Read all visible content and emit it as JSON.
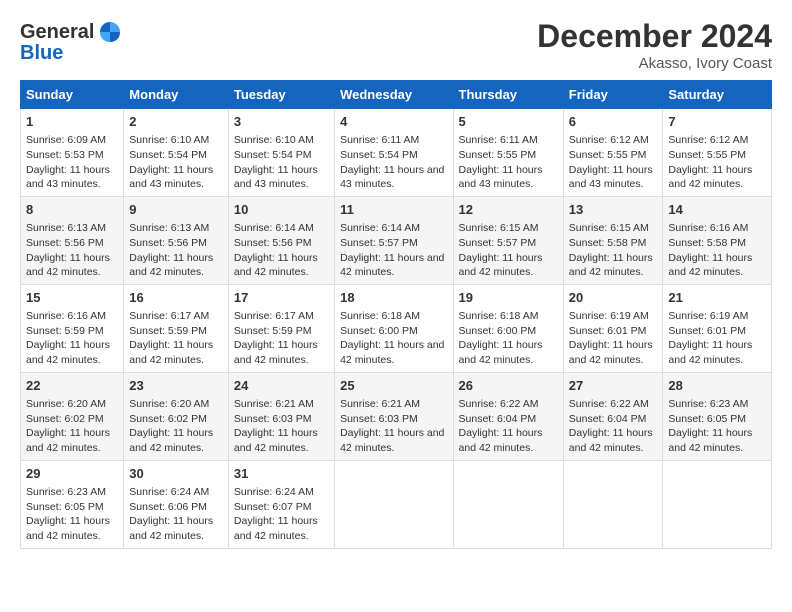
{
  "logo": {
    "line1": "General",
    "line2": "Blue"
  },
  "title": "December 2024",
  "subtitle": "Akasso, Ivory Coast",
  "days_of_week": [
    "Sunday",
    "Monday",
    "Tuesday",
    "Wednesday",
    "Thursday",
    "Friday",
    "Saturday"
  ],
  "weeks": [
    [
      {
        "day": "1",
        "sunrise": "Sunrise: 6:09 AM",
        "sunset": "Sunset: 5:53 PM",
        "daylight": "Daylight: 11 hours and 43 minutes."
      },
      {
        "day": "2",
        "sunrise": "Sunrise: 6:10 AM",
        "sunset": "Sunset: 5:54 PM",
        "daylight": "Daylight: 11 hours and 43 minutes."
      },
      {
        "day": "3",
        "sunrise": "Sunrise: 6:10 AM",
        "sunset": "Sunset: 5:54 PM",
        "daylight": "Daylight: 11 hours and 43 minutes."
      },
      {
        "day": "4",
        "sunrise": "Sunrise: 6:11 AM",
        "sunset": "Sunset: 5:54 PM",
        "daylight": "Daylight: 11 hours and 43 minutes."
      },
      {
        "day": "5",
        "sunrise": "Sunrise: 6:11 AM",
        "sunset": "Sunset: 5:55 PM",
        "daylight": "Daylight: 11 hours and 43 minutes."
      },
      {
        "day": "6",
        "sunrise": "Sunrise: 6:12 AM",
        "sunset": "Sunset: 5:55 PM",
        "daylight": "Daylight: 11 hours and 43 minutes."
      },
      {
        "day": "7",
        "sunrise": "Sunrise: 6:12 AM",
        "sunset": "Sunset: 5:55 PM",
        "daylight": "Daylight: 11 hours and 42 minutes."
      }
    ],
    [
      {
        "day": "8",
        "sunrise": "Sunrise: 6:13 AM",
        "sunset": "Sunset: 5:56 PM",
        "daylight": "Daylight: 11 hours and 42 minutes."
      },
      {
        "day": "9",
        "sunrise": "Sunrise: 6:13 AM",
        "sunset": "Sunset: 5:56 PM",
        "daylight": "Daylight: 11 hours and 42 minutes."
      },
      {
        "day": "10",
        "sunrise": "Sunrise: 6:14 AM",
        "sunset": "Sunset: 5:56 PM",
        "daylight": "Daylight: 11 hours and 42 minutes."
      },
      {
        "day": "11",
        "sunrise": "Sunrise: 6:14 AM",
        "sunset": "Sunset: 5:57 PM",
        "daylight": "Daylight: 11 hours and 42 minutes."
      },
      {
        "day": "12",
        "sunrise": "Sunrise: 6:15 AM",
        "sunset": "Sunset: 5:57 PM",
        "daylight": "Daylight: 11 hours and 42 minutes."
      },
      {
        "day": "13",
        "sunrise": "Sunrise: 6:15 AM",
        "sunset": "Sunset: 5:58 PM",
        "daylight": "Daylight: 11 hours and 42 minutes."
      },
      {
        "day": "14",
        "sunrise": "Sunrise: 6:16 AM",
        "sunset": "Sunset: 5:58 PM",
        "daylight": "Daylight: 11 hours and 42 minutes."
      }
    ],
    [
      {
        "day": "15",
        "sunrise": "Sunrise: 6:16 AM",
        "sunset": "Sunset: 5:59 PM",
        "daylight": "Daylight: 11 hours and 42 minutes."
      },
      {
        "day": "16",
        "sunrise": "Sunrise: 6:17 AM",
        "sunset": "Sunset: 5:59 PM",
        "daylight": "Daylight: 11 hours and 42 minutes."
      },
      {
        "day": "17",
        "sunrise": "Sunrise: 6:17 AM",
        "sunset": "Sunset: 5:59 PM",
        "daylight": "Daylight: 11 hours and 42 minutes."
      },
      {
        "day": "18",
        "sunrise": "Sunrise: 6:18 AM",
        "sunset": "Sunset: 6:00 PM",
        "daylight": "Daylight: 11 hours and 42 minutes."
      },
      {
        "day": "19",
        "sunrise": "Sunrise: 6:18 AM",
        "sunset": "Sunset: 6:00 PM",
        "daylight": "Daylight: 11 hours and 42 minutes."
      },
      {
        "day": "20",
        "sunrise": "Sunrise: 6:19 AM",
        "sunset": "Sunset: 6:01 PM",
        "daylight": "Daylight: 11 hours and 42 minutes."
      },
      {
        "day": "21",
        "sunrise": "Sunrise: 6:19 AM",
        "sunset": "Sunset: 6:01 PM",
        "daylight": "Daylight: 11 hours and 42 minutes."
      }
    ],
    [
      {
        "day": "22",
        "sunrise": "Sunrise: 6:20 AM",
        "sunset": "Sunset: 6:02 PM",
        "daylight": "Daylight: 11 hours and 42 minutes."
      },
      {
        "day": "23",
        "sunrise": "Sunrise: 6:20 AM",
        "sunset": "Sunset: 6:02 PM",
        "daylight": "Daylight: 11 hours and 42 minutes."
      },
      {
        "day": "24",
        "sunrise": "Sunrise: 6:21 AM",
        "sunset": "Sunset: 6:03 PM",
        "daylight": "Daylight: 11 hours and 42 minutes."
      },
      {
        "day": "25",
        "sunrise": "Sunrise: 6:21 AM",
        "sunset": "Sunset: 6:03 PM",
        "daylight": "Daylight: 11 hours and 42 minutes."
      },
      {
        "day": "26",
        "sunrise": "Sunrise: 6:22 AM",
        "sunset": "Sunset: 6:04 PM",
        "daylight": "Daylight: 11 hours and 42 minutes."
      },
      {
        "day": "27",
        "sunrise": "Sunrise: 6:22 AM",
        "sunset": "Sunset: 6:04 PM",
        "daylight": "Daylight: 11 hours and 42 minutes."
      },
      {
        "day": "28",
        "sunrise": "Sunrise: 6:23 AM",
        "sunset": "Sunset: 6:05 PM",
        "daylight": "Daylight: 11 hours and 42 minutes."
      }
    ],
    [
      {
        "day": "29",
        "sunrise": "Sunrise: 6:23 AM",
        "sunset": "Sunset: 6:05 PM",
        "daylight": "Daylight: 11 hours and 42 minutes."
      },
      {
        "day": "30",
        "sunrise": "Sunrise: 6:24 AM",
        "sunset": "Sunset: 6:06 PM",
        "daylight": "Daylight: 11 hours and 42 minutes."
      },
      {
        "day": "31",
        "sunrise": "Sunrise: 6:24 AM",
        "sunset": "Sunset: 6:07 PM",
        "daylight": "Daylight: 11 hours and 42 minutes."
      },
      {
        "day": "",
        "sunrise": "",
        "sunset": "",
        "daylight": ""
      },
      {
        "day": "",
        "sunrise": "",
        "sunset": "",
        "daylight": ""
      },
      {
        "day": "",
        "sunrise": "",
        "sunset": "",
        "daylight": ""
      },
      {
        "day": "",
        "sunrise": "",
        "sunset": "",
        "daylight": ""
      }
    ]
  ]
}
